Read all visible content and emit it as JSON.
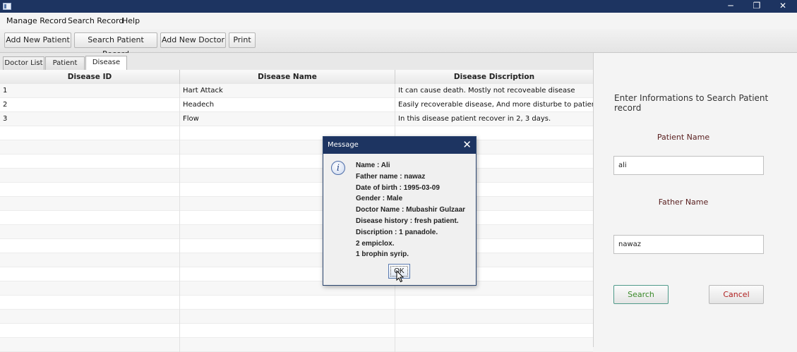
{
  "window": {
    "minimize_glyph": "─",
    "restore_glyph": "❐",
    "close_glyph": "✕"
  },
  "menu": {
    "items": [
      "Manage Record",
      "Search Record",
      "Help"
    ]
  },
  "toolbar": {
    "buttons": [
      "Add New Patient",
      "Search Patient Record",
      "Add New Doctor",
      "Print"
    ]
  },
  "tabs": [
    {
      "label": "Doctor List",
      "active": false
    },
    {
      "label": "Patient List",
      "active": false
    },
    {
      "label": "Disease List",
      "active": true
    }
  ],
  "table": {
    "columns": [
      "Disease ID",
      "Disease Name",
      "Disease Discription"
    ],
    "rows": [
      [
        "1",
        "Hart Attack",
        "It can cause death. Mostly not recoveable disease"
      ],
      [
        "2",
        "Headech",
        "Easily recoverable disease, And more disturbe to patient."
      ],
      [
        "3",
        "Flow",
        "In this disease patient recover in 2, 3 days."
      ]
    ]
  },
  "search_panel": {
    "heading": "Enter Informations to Search Patient record",
    "patient_name_label": "Patient Name",
    "patient_name_value": "ali",
    "father_name_label": "Father Name",
    "father_name_value": "nawaz",
    "search_button": "Search",
    "cancel_button": "Cancel"
  },
  "dialog": {
    "title": "Message",
    "close_glyph": "✕",
    "icon": "info-icon",
    "lines": [
      "Name : Ali",
      "Father name : nawaz",
      "Date of birth : 1995-03-09",
      "Gender : Male",
      "Doctor Name : Mubashir Gulzaar",
      "Disease history : fresh patient.",
      "Discription : 1 panadole.",
      "2 empiclox.",
      "1 brophin syrip."
    ],
    "ok_button": "OK"
  },
  "colors": {
    "titlebar": "#1d3461",
    "label_text": "#5a2020",
    "search_text": "#3b8a2a",
    "search_border": "#4f9a8a",
    "cancel_text": "#b02020"
  }
}
